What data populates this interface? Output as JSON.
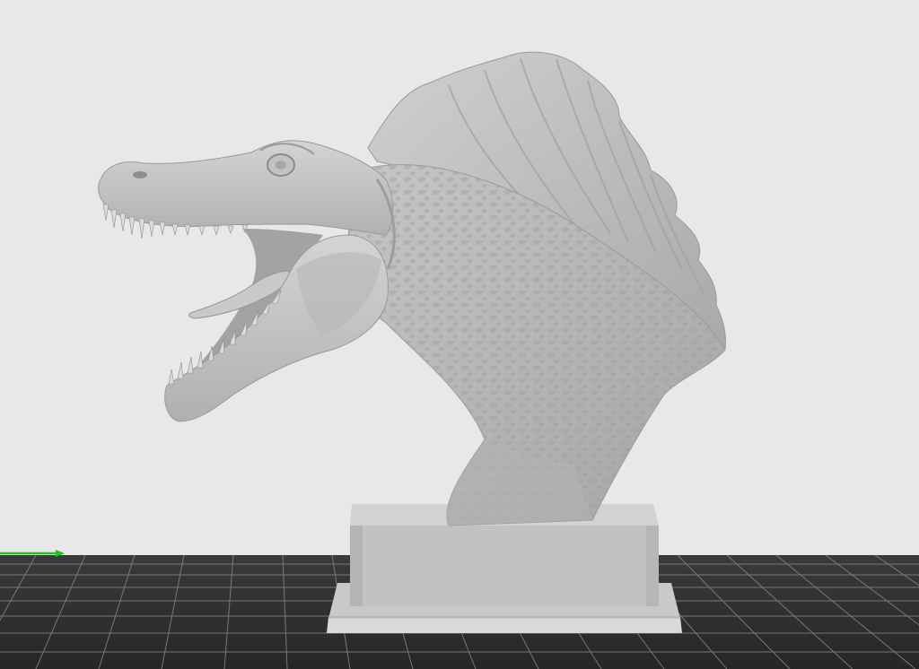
{
  "viewport": {
    "background_color": "#e8e8e8",
    "build_plate_color": "#2e2e2e",
    "grid_line_color": "#8a8a8a",
    "x_axis_color": "#22c022",
    "model_color": "#bdbdbd",
    "pedestal_color": "#c4c4c4"
  },
  "model": {
    "subject": "spinosaurus-head-bust",
    "parts": [
      "head",
      "jaws",
      "tongue",
      "sail",
      "neck",
      "pedestal"
    ]
  }
}
